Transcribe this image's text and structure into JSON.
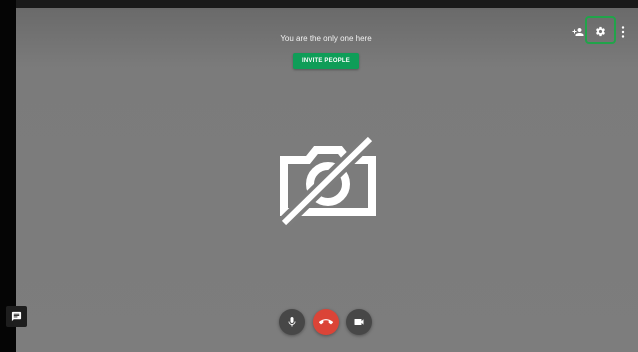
{
  "meeting": {
    "status_text": "You are the only one here",
    "invite_label": "INVITE PEOPLE"
  },
  "toolbar": {
    "icons": [
      "add-person-icon",
      "gear-icon",
      "more-vert-icon"
    ],
    "highlighted": "gear-icon"
  },
  "controls": {
    "icons": [
      "mic-icon",
      "call-end-icon",
      "videocam-icon"
    ]
  },
  "sidebar": {
    "icons": [
      "chat-icon"
    ]
  },
  "colors": {
    "stage": "#7d7d7d",
    "invite_button": "#0f9d58",
    "hangup_button": "#db4437",
    "highlight_border": "#21a44a",
    "control_button": "#474747"
  }
}
